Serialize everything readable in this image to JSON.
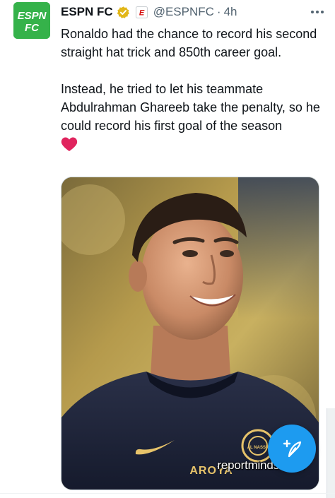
{
  "tweet": {
    "display_name": "ESPN FC",
    "handle": "@ESPNFC",
    "separator": "·",
    "time": "4h",
    "avatar_text_line1": "ESPN",
    "avatar_text_line2": "FC",
    "paragraph1": "Ronaldo had the chance to record his second straight hat trick and 850th career goal.",
    "paragraph2": "Instead, he tried to let his teammate Abdulrahman Ghareeb take the penalty, so he could record his first goal of the season",
    "emoji": "red-heart"
  },
  "media": {
    "watermark": "reportminds.com",
    "jersey_text": "AROYA",
    "crest_text": "AL NASSR"
  },
  "colors": {
    "brand_green": "#35b24a",
    "verified_gold": "#e2b719",
    "link_blue": "#1d9bf0",
    "muted": "#536471",
    "heart_red": "#e0245e"
  },
  "icons": {
    "verified": "verified-badge-icon",
    "affiliate": "espn-affiliate-icon",
    "more": "more-icon",
    "compose": "compose-icon"
  }
}
